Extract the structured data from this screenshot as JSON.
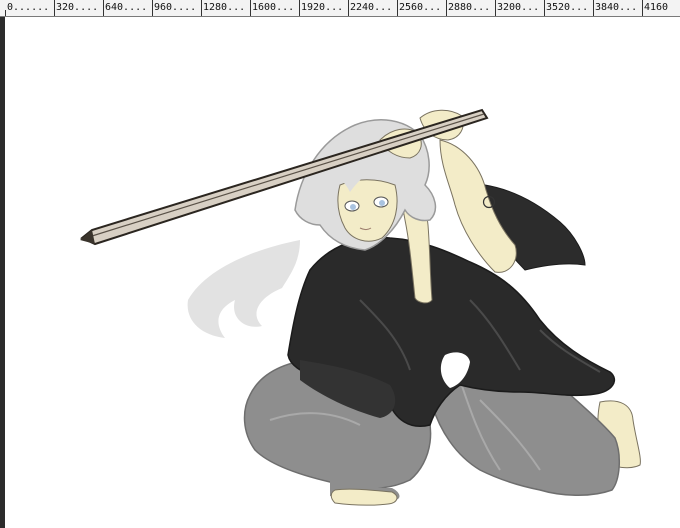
{
  "ruler": {
    "labels": [
      "0",
      "320",
      "640",
      "960",
      "1280",
      "1600",
      "1920",
      "2240",
      "2560",
      "2880",
      "3200",
      "3520",
      "3840",
      "4160"
    ]
  },
  "canvas": {
    "artwork": "drawing-canvas",
    "colors": {
      "robe": "#2a2a2a",
      "hakama": "#8e8e8e",
      "skin": "#f3ecc8",
      "hair": "#dedede",
      "sword": "#d8d0c4"
    }
  }
}
